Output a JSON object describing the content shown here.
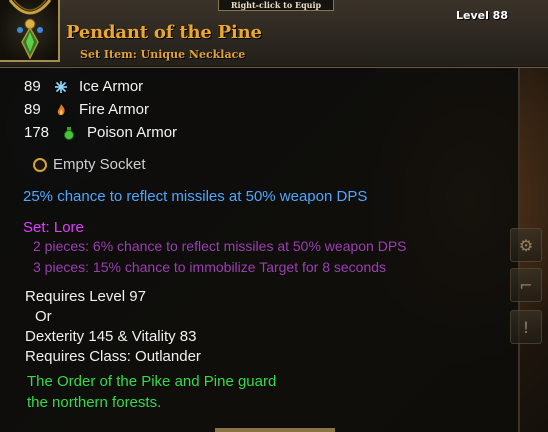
{
  "tooltip": {
    "equip_hint": "Right-click to Equip",
    "item_name": "Pendant of the Pine",
    "item_type": "Set Item: Unique Necklace",
    "item_level": "Level 88",
    "armor": [
      {
        "value": "89",
        "label": "Ice Armor",
        "icon": "snowflake-icon",
        "color": "#7fd0ff"
      },
      {
        "value": "89",
        "label": "Fire Armor",
        "icon": "flame-icon",
        "color": "#e07a2a"
      },
      {
        "value": "178",
        "label": "Poison Armor",
        "icon": "poison-flask-icon",
        "color": "#4cc43a"
      }
    ],
    "socket": "Empty Socket",
    "reflect_line": "25% chance to reflect missiles at 50% weapon DPS",
    "set_name": "Set: Lore",
    "set_bonuses": [
      "2 pieces: 6% chance to reflect missiles at 50% weapon DPS",
      "3 pieces: 15% chance to immobilize Target for 8 seconds"
    ],
    "requirements": {
      "level": "Requires Level 97",
      "or": "Or",
      "stats": "Dexterity 145 & Vitality 83",
      "class": "Requires Class: Outlander"
    },
    "flavor": [
      "The Order of the Pike and Pine guard",
      "the northern forests."
    ]
  },
  "colors": {
    "item_name": "#e8a832",
    "magic_blue": "#4fa6ff",
    "set_title": "#e040ff",
    "set_bonus": "#9a3fb0",
    "flavor_green": "#35d94a"
  }
}
